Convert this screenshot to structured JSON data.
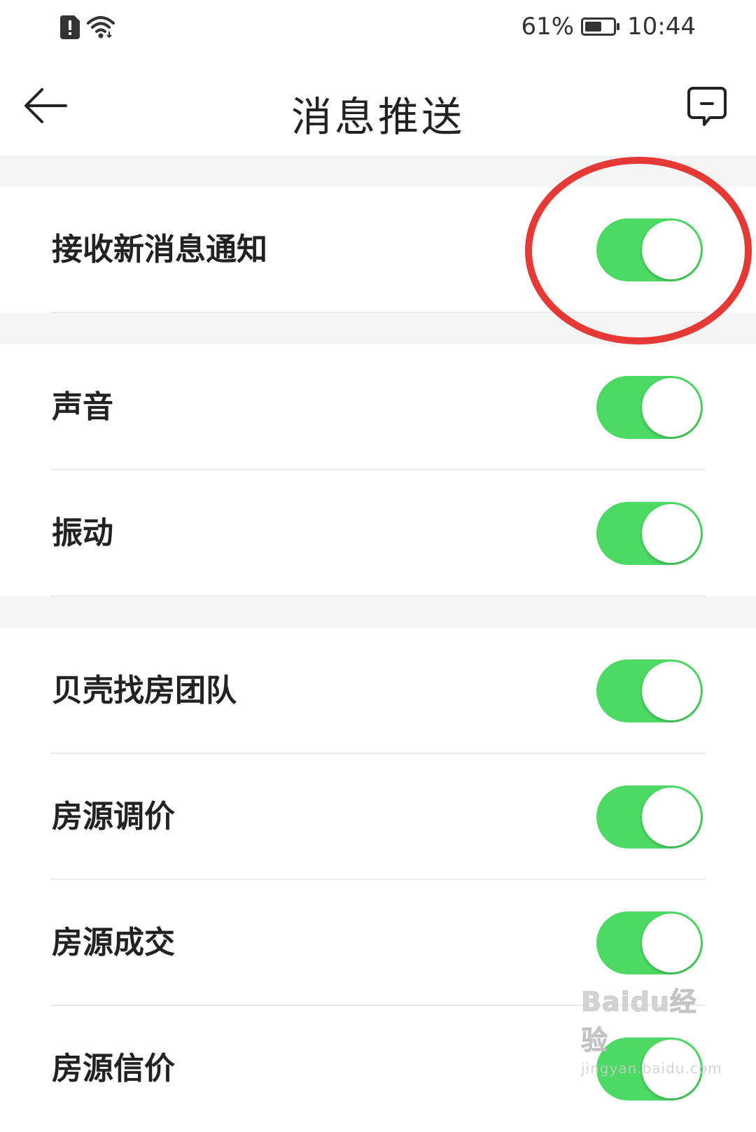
{
  "status_bar": {
    "battery_percent_text": "61%",
    "battery_level": 0.61,
    "time": "10:44",
    "icons": [
      "sim-alert-icon",
      "wifi-icon"
    ]
  },
  "header": {
    "title": "消息推送",
    "back_icon": "arrow-left-icon",
    "feedback_icon": "feedback-message-icon"
  },
  "colors": {
    "toggle_on": "#4cd964",
    "annotation": "#e53935",
    "section_gap": "#f5f5f5"
  },
  "settings": {
    "group1": [
      {
        "label": "接收新消息通知",
        "enabled": true
      }
    ],
    "group2": [
      {
        "label": "声音",
        "enabled": true
      },
      {
        "label": "振动",
        "enabled": true
      }
    ],
    "group3": [
      {
        "label": "贝壳找房团队",
        "enabled": true
      },
      {
        "label": "房源调价",
        "enabled": true
      },
      {
        "label": "房源成交",
        "enabled": true
      },
      {
        "label": "房源信价",
        "enabled": true
      }
    ]
  },
  "watermark": {
    "main": "Baidu经验",
    "sub": "jingyan.baidu.com"
  }
}
